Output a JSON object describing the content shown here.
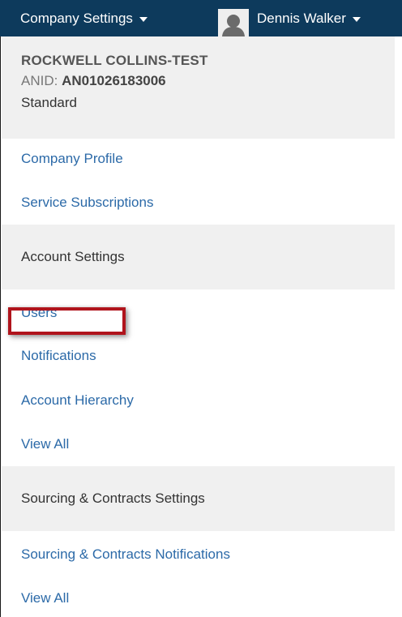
{
  "topbar": {
    "company_menu_label": "Company Settings",
    "user_menu_label": "Dennis Walker",
    "background_color": "#0d3a5c"
  },
  "account": {
    "company_name": "ROCKWELL COLLINS-TEST",
    "anid_label": "ANID:",
    "anid_value": "AN01026183006",
    "plan": "Standard"
  },
  "company_section": {
    "links": [
      "Company Profile",
      "Service Subscriptions"
    ]
  },
  "account_settings": {
    "header": "Account Settings",
    "links": [
      "Users",
      "Notifications",
      "Account Hierarchy",
      "View All"
    ]
  },
  "sourcing_settings": {
    "header": "Sourcing & Contracts Settings",
    "links": [
      "Sourcing & Contracts Notifications",
      "View All"
    ]
  },
  "colors": {
    "link": "#2c6aa8",
    "highlight_border": "#b0141c",
    "section_background": "#f0f0f0"
  },
  "icons": {
    "avatar": "user-avatar-icon",
    "caret": "caret-down-icon"
  }
}
